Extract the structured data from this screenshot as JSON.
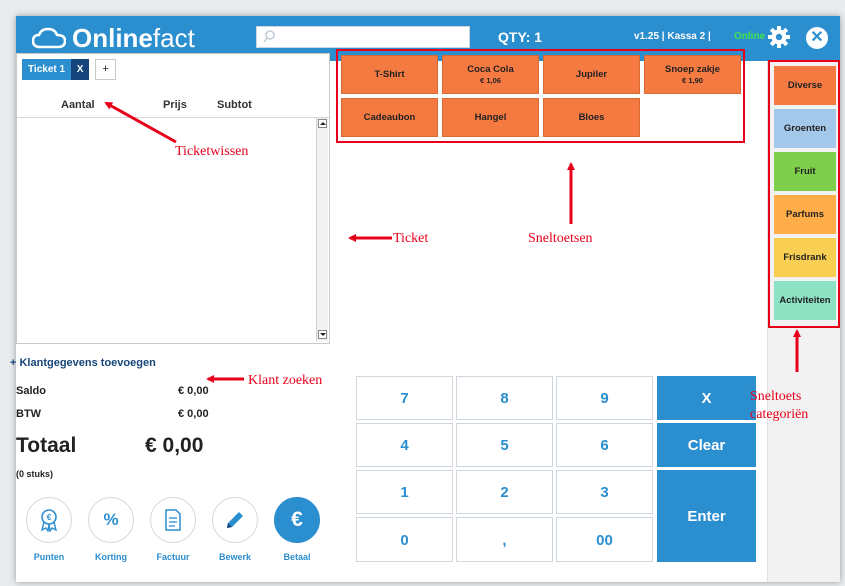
{
  "header": {
    "logo_bold": "Online",
    "logo_light": "fact",
    "search_placeholder": "",
    "qty": "QTY: 1",
    "version": "v1.25 | Kassa  2 |",
    "status": "Online",
    "status_color": "#3fe34f",
    "brand_color": "#2b8ecf"
  },
  "ticket": {
    "tab_label": "Ticket 1",
    "tab_close": "X",
    "add_tab": "+",
    "columns": [
      "Aantal",
      "Prijs",
      "Subtot"
    ]
  },
  "customer": {
    "add_link": "+ Klantgegevens toevoegen"
  },
  "totals": {
    "saldo_label": "Saldo",
    "saldo_value": "€ 0,00",
    "btw_label": "BTW",
    "btw_value": "€ 0,00",
    "totaal_label": "Totaal",
    "totaal_value": "€ 0,00",
    "count": "(0 stuks)"
  },
  "actions": [
    {
      "label": "Punten",
      "icon": "award-icon"
    },
    {
      "label": "Korting",
      "icon": "%"
    },
    {
      "label": "Factuur",
      "icon": "document-icon"
    },
    {
      "label": "Bewerk",
      "icon": "pencil-icon"
    },
    {
      "label": "Betaal",
      "icon": "€"
    }
  ],
  "shortcuts": [
    {
      "label": "T-Shirt",
      "price": ""
    },
    {
      "label": "Coca Cola",
      "price": "€ 1,06"
    },
    {
      "label": "Jupiler",
      "price": ""
    },
    {
      "label": "Snoep zakje",
      "price": "€ 1,90"
    },
    {
      "label": "Cadeaubon",
      "price": ""
    },
    {
      "label": "Hangel",
      "price": ""
    },
    {
      "label": "Bloes",
      "price": ""
    }
  ],
  "shortcut_color": "#f57a41",
  "categories": [
    {
      "label": "Diverse",
      "color": "#f57a41"
    },
    {
      "label": "Groenten",
      "color": "#a4c8ea"
    },
    {
      "label": "Fruit",
      "color": "#7ed04c"
    },
    {
      "label": "Parfums",
      "color": "#ffad48"
    },
    {
      "label": "Frisdrank",
      "color": "#f8cf52"
    },
    {
      "label": "Activiteiten",
      "color": "#8ce2c2"
    }
  ],
  "numpad": {
    "keys": [
      "7",
      "8",
      "9",
      "4",
      "5",
      "6",
      "1",
      "2",
      "3",
      "0",
      ",",
      "00"
    ],
    "x_label": "X",
    "clear_label": "Clear",
    "enter_label": "Enter"
  },
  "annotations": {
    "ticketwissen": "Ticketwissen",
    "ticket": "Ticket",
    "sneltoetsen": "Sneltoetsen",
    "klant_zoeken": "Klant zoeken",
    "sneltoets_line1": "Sneltoets",
    "sneltoets_line2": "categoriën"
  }
}
